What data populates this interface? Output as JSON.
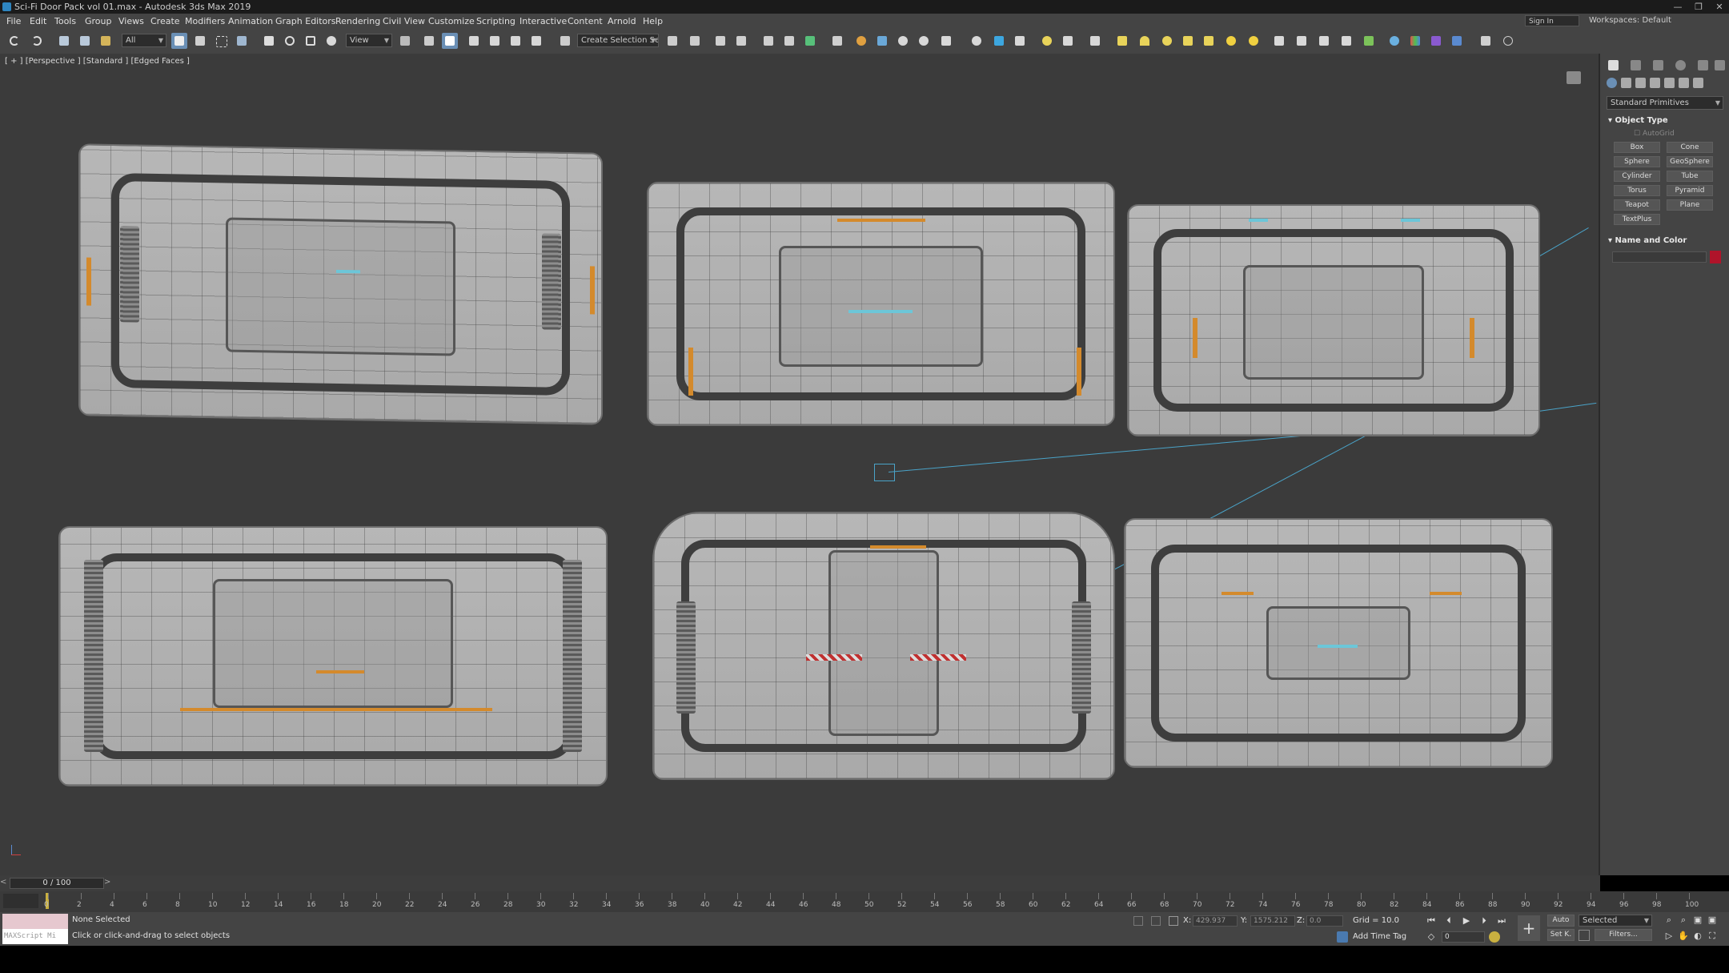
{
  "window": {
    "title": "Sci-Fi Door Pack vol 01.max - Autodesk 3ds Max 2019",
    "controls": [
      "—",
      "❐",
      "✕"
    ]
  },
  "menu": [
    "File",
    "Edit",
    "Tools",
    "Group",
    "Views",
    "Create",
    "Modifiers",
    "Animation",
    "Graph Editors",
    "Rendering",
    "Civil View",
    "Customize",
    "Scripting",
    "Interactive",
    "Content",
    "Arnold",
    "Help"
  ],
  "account": {
    "signin": "Sign In",
    "workspaces_label": "Workspaces:",
    "workspace": "Default"
  },
  "toolbar": {
    "selection_filter": "All",
    "reference_coord": "View",
    "named_selection_placeholder": "Create Selection Set"
  },
  "viewport": {
    "label": "[ + ] [Perspective ] [Standard ] [Edged Faces ]"
  },
  "command_panel": {
    "category": "Standard Primitives",
    "object_type_title": "Object Type",
    "autogrid": "AutoGrid",
    "primitives": [
      "Box",
      "Cone",
      "Sphere",
      "GeoSphere",
      "Cylinder",
      "Tube",
      "Torus",
      "Pyramid",
      "Teapot",
      "Plane",
      "TextPlus"
    ],
    "name_color_title": "Name and Color",
    "object_color": "#b0142a"
  },
  "timeline": {
    "frame_display": "0 / 100",
    "prev": "<",
    "next": ">",
    "ticks": [
      "0",
      "2",
      "4",
      "6",
      "8",
      "10",
      "12",
      "14",
      "16",
      "18",
      "20",
      "22",
      "24",
      "26",
      "28",
      "30",
      "32",
      "34",
      "36",
      "38",
      "40",
      "42",
      "44",
      "46",
      "48",
      "50",
      "52",
      "54",
      "56",
      "58",
      "60",
      "62",
      "64",
      "66",
      "68",
      "70",
      "72",
      "74",
      "76",
      "78",
      "80",
      "82",
      "84",
      "86",
      "88",
      "90",
      "92",
      "94",
      "96",
      "98",
      "100"
    ]
  },
  "status": {
    "maxscript_label": "MAXScript Mi",
    "selection": "None Selected",
    "prompt": "Click or click-and-drag to select objects",
    "x_label": "X:",
    "x_value": "429.937",
    "y_label": "Y:",
    "y_value": "1575.212",
    "z_label": "Z:",
    "z_value": "0.0",
    "grid": "Grid = 10.0",
    "add_time_tag": "Add Time Tag",
    "auto_key": "Auto",
    "set_key": "Set K.",
    "key_filter": "Selected",
    "filters": "Filters...",
    "current_frame": "0"
  }
}
